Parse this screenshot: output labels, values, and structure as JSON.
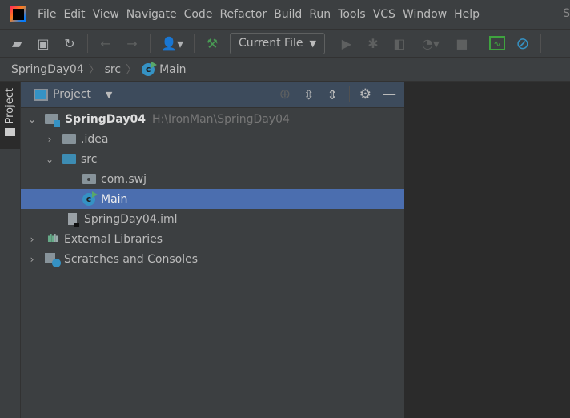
{
  "window": {
    "title_fragment": "S"
  },
  "menu": [
    "File",
    "Edit",
    "View",
    "Navigate",
    "Code",
    "Refactor",
    "Build",
    "Run",
    "Tools",
    "VCS",
    "Window",
    "Help"
  ],
  "toolbar": {
    "run_config": "Current File",
    "icons": [
      "open-folder",
      "save",
      "sync",
      "back",
      "forward",
      "user",
      "build-hammer",
      "run",
      "debug",
      "coverage",
      "profile",
      "stop",
      "monitor",
      "power-save"
    ]
  },
  "breadcrumb": [
    "SpringDay04",
    "src",
    "Main"
  ],
  "stripe": {
    "project_tab": "Project"
  },
  "project_panel": {
    "title": "Project",
    "tree": [
      {
        "label": "SpringDay04",
        "hint": "H:\\IronMan\\SpringDay04",
        "expanded": true
      },
      {
        "label": ".idea",
        "expanded": false
      },
      {
        "label": "src",
        "expanded": true
      },
      {
        "label": "com.swj"
      },
      {
        "label": "Main",
        "selected": true
      },
      {
        "label": "SpringDay04.iml"
      },
      {
        "label": "External Libraries",
        "expanded": false
      },
      {
        "label": "Scratches and Consoles",
        "expanded": false
      }
    ]
  },
  "colors": {
    "selection": "#4b6eaf",
    "panel_header": "#3d4b5c",
    "editor_bg": "#2b2b2b"
  }
}
